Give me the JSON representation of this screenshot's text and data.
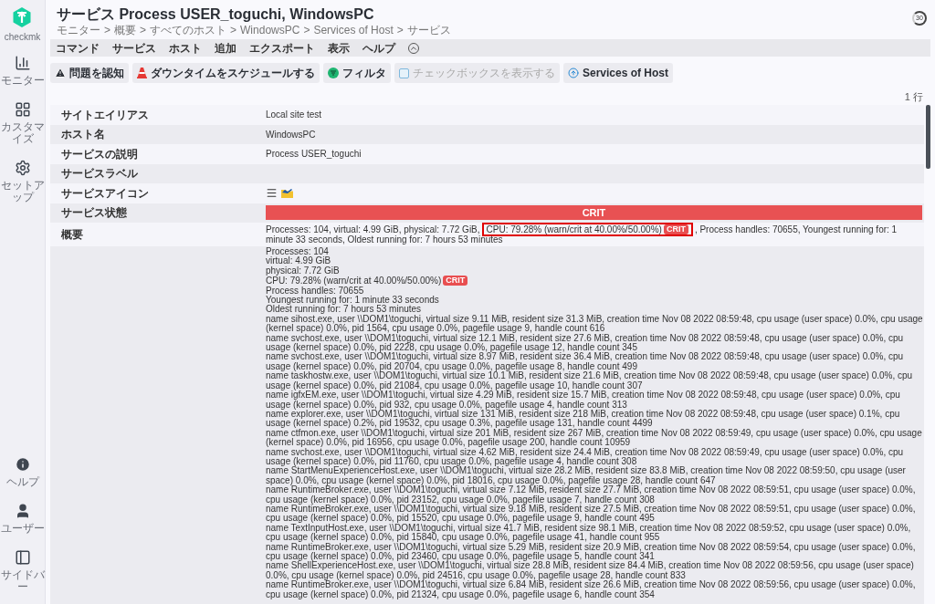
{
  "sidebar": {
    "logo_label": "checkmk",
    "items": [
      {
        "kind": "monitor",
        "label": "モニター"
      },
      {
        "kind": "customize",
        "label": "カスタマイズ"
      },
      {
        "kind": "setup",
        "label": "セットアップ"
      }
    ],
    "bottom_items": [
      {
        "kind": "help",
        "label": "ヘルプ"
      },
      {
        "kind": "user",
        "label": "ユーザー"
      },
      {
        "kind": "sidebar",
        "label": "サイドバー"
      }
    ]
  },
  "header": {
    "title": "サービス Process USER_toguchi, WindowsPC",
    "separator": ">",
    "breadcrumb": [
      "モニター",
      "概要",
      "すべてのホスト",
      "WindowsPC",
      "Services of Host",
      "サービス"
    ],
    "refresh": "30"
  },
  "menu": [
    "コマンド",
    "サービス",
    "ホスト",
    "追加",
    "エクスポート",
    "表示",
    "ヘルプ"
  ],
  "toolbar": [
    {
      "kind": "warning",
      "label": "問題を認知",
      "disabled": false
    },
    {
      "kind": "downtime",
      "label": "ダウンタイムをスケジュールする",
      "disabled": false
    },
    {
      "kind": "filter",
      "label": "フィルタ",
      "disabled": false
    },
    {
      "kind": "checkbox",
      "label": "チェックボックスを表示する",
      "disabled": true
    },
    {
      "kind": "up",
      "label": "Services of Host",
      "disabled": false
    }
  ],
  "row_count": "1 行",
  "properties": [
    {
      "kind": "text",
      "label": "サイトエイリアス",
      "value": "Local site test"
    },
    {
      "kind": "text",
      "label": "ホスト名",
      "value": "WindowsPC"
    },
    {
      "kind": "text",
      "label": "サービスの説明",
      "value": "Process USER_toguchi"
    },
    {
      "kind": "empty",
      "label": "サービスラベル"
    },
    {
      "kind": "icons",
      "label": "サービスアイコン"
    },
    {
      "kind": "state",
      "label": "サービス状態",
      "value": "CRIT"
    },
    {
      "kind": "summary",
      "label": "概要",
      "parts": [
        {
          "text": "Processes: 104, virtual: 4.99 GiB, physical: 7.72 GiB,",
          "highlighted": false
        },
        {
          "text": "CPU: 79.28% (warn/crit at 40.00%/50.00%)",
          "badge": "CRIT",
          "highlighted": true
        },
        {
          "text": ", Process handles: 70655, Youngest running for: 1 minute 33 seconds, Oldest running for: 7 hours 53 minutes",
          "highlighted": false
        }
      ]
    }
  ],
  "details": [
    {
      "text": "Processes: 104"
    },
    {
      "text": "virtual: 4.99 GiB"
    },
    {
      "text": "physical: 7.72 GiB"
    },
    {
      "text": "CPU: 79.28% (warn/crit at 40.00%/50.00%)",
      "badge": "CRIT"
    },
    {
      "text": "Process handles: 70655"
    },
    {
      "text": "Youngest running for: 1 minute 33 seconds"
    },
    {
      "text": "Oldest running for: 7 hours 53 minutes"
    },
    {
      "text": "name sihost.exe, user \\\\DOM1\\toguchi, virtual size 9.11 MiB, resident size 31.3 MiB, creation time Nov 08 2022 08:59:48, cpu usage (user space) 0.0%, cpu usage (kernel space) 0.0%, pid 1564, cpu usage 0.0%, pagefile usage 9, handle count 616"
    },
    {
      "text": "name svchost.exe, user \\\\DOM1\\toguchi, virtual size 12.1 MiB, resident size 27.6 MiB, creation time Nov 08 2022 08:59:48, cpu usage (user space) 0.0%, cpu usage (kernel space) 0.0%, pid 2228, cpu usage 0.0%, pagefile usage 12, handle count 345"
    },
    {
      "text": "name svchost.exe, user \\\\DOM1\\toguchi, virtual size 8.97 MiB, resident size 36.4 MiB, creation time Nov 08 2022 08:59:48, cpu usage (user space) 0.0%, cpu usage (kernel space) 0.0%, pid 20704, cpu usage 0.0%, pagefile usage 8, handle count 499"
    },
    {
      "text": "name taskhostw.exe, user \\\\DOM1\\toguchi, virtual size 10.1 MiB, resident size 21.6 MiB, creation time Nov 08 2022 08:59:48, cpu usage (user space) 0.0%, cpu usage (kernel space) 0.0%, pid 21084, cpu usage 0.0%, pagefile usage 10, handle count 307"
    },
    {
      "text": "name igfxEM.exe, user \\\\DOM1\\toguchi, virtual size 4.29 MiB, resident size 15.7 MiB, creation time Nov 08 2022 08:59:48, cpu usage (user space) 0.0%, cpu usage (kernel space) 0.0%, pid 932, cpu usage 0.0%, pagefile usage 4, handle count 313"
    },
    {
      "text": "name explorer.exe, user \\\\DOM1\\toguchi, virtual size 131 MiB, resident size 218 MiB, creation time Nov 08 2022 08:59:48, cpu usage (user space) 0.1%, cpu usage (kernel space) 0.2%, pid 19532, cpu usage 0.3%, pagefile usage 131, handle count 4499"
    },
    {
      "text": "name ctfmon.exe, user \\\\DOM1\\toguchi, virtual size 201 MiB, resident size 267 MiB, creation time Nov 08 2022 08:59:49, cpu usage (user space) 0.0%, cpu usage (kernel space) 0.0%, pid 16956, cpu usage 0.0%, pagefile usage 200, handle count 10959"
    },
    {
      "text": "name svchost.exe, user \\\\DOM1\\toguchi, virtual size 4.62 MiB, resident size 24.4 MiB, creation time Nov 08 2022 08:59:49, cpu usage (user space) 0.0%, cpu usage (kernel space) 0.0%, pid 11760, cpu usage 0.0%, pagefile usage 4, handle count 308"
    },
    {
      "text": "name StartMenuExperienceHost.exe, user \\\\DOM1\\toguchi, virtual size 28.2 MiB, resident size 83.8 MiB, creation time Nov 08 2022 08:59:50, cpu usage (user space) 0.0%, cpu usage (kernel space) 0.0%, pid 18016, cpu usage 0.0%, pagefile usage 28, handle count 647"
    },
    {
      "text": "name RuntimeBroker.exe, user \\\\DOM1\\toguchi, virtual size 7.12 MiB, resident size 27.7 MiB, creation time Nov 08 2022 08:59:51, cpu usage (user space) 0.0%, cpu usage (kernel space) 0.0%, pid 23152, cpu usage 0.0%, pagefile usage 7, handle count 308"
    },
    {
      "text": "name RuntimeBroker.exe, user \\\\DOM1\\toguchi, virtual size 9.18 MiB, resident size 27.5 MiB, creation time Nov 08 2022 08:59:51, cpu usage (user space) 0.0%, cpu usage (kernel space) 0.0%, pid 15520, cpu usage 0.0%, pagefile usage 9, handle count 495"
    },
    {
      "text": "name TextInputHost.exe, user \\\\DOM1\\toguchi, virtual size 41.7 MiB, resident size 98.1 MiB, creation time Nov 08 2022 08:59:52, cpu usage (user space) 0.0%, cpu usage (kernel space) 0.0%, pid 15840, cpu usage 0.0%, pagefile usage 41, handle count 955"
    },
    {
      "text": "name RuntimeBroker.exe, user \\\\DOM1\\toguchi, virtual size 5.29 MiB, resident size 20.9 MiB, creation time Nov 08 2022 08:59:54, cpu usage (user space) 0.0%, cpu usage (kernel space) 0.0%, pid 23460, cpu usage 0.0%, pagefile usage 5, handle count 341"
    },
    {
      "text": "name ShellExperienceHost.exe, user \\\\DOM1\\toguchi, virtual size 28.8 MiB, resident size 84.4 MiB, creation time Nov 08 2022 08:59:56, cpu usage (user space) 0.0%, cpu usage (kernel space) 0.0%, pid 24516, cpu usage 0.0%, pagefile usage 28, handle count 833"
    },
    {
      "text": "name RuntimeBroker.exe, user \\\\DOM1\\toguchi, virtual size 6.84 MiB, resident size 26.6 MiB, creation time Nov 08 2022 08:59:56, cpu usage (user space) 0.0%, cpu usage (kernel space) 0.0%, pid 21324, cpu usage 0.0%, pagefile usage 6, handle count 354"
    }
  ]
}
